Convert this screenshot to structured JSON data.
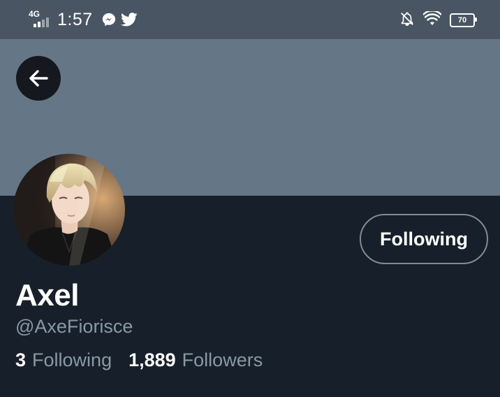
{
  "status_bar": {
    "network": "4G",
    "time": "1:57",
    "battery_level": "70",
    "left_icons": [
      "messenger-icon",
      "twitter-icon"
    ],
    "right_icons": [
      "bell-off-icon",
      "wifi-icon",
      "battery-icon"
    ]
  },
  "profile": {
    "name": "Axel",
    "handle": "@AxeFiorisce",
    "follow_button_label": "Following",
    "stats": [
      {
        "count": "3",
        "label": "Following"
      },
      {
        "count": "1,889",
        "label": "Followers"
      }
    ]
  },
  "colors": {
    "background": "#17202a",
    "banner": "#657786",
    "status_bar": "#4a5563",
    "secondary_text": "#8899a6",
    "primary_text": "#ffffff"
  }
}
